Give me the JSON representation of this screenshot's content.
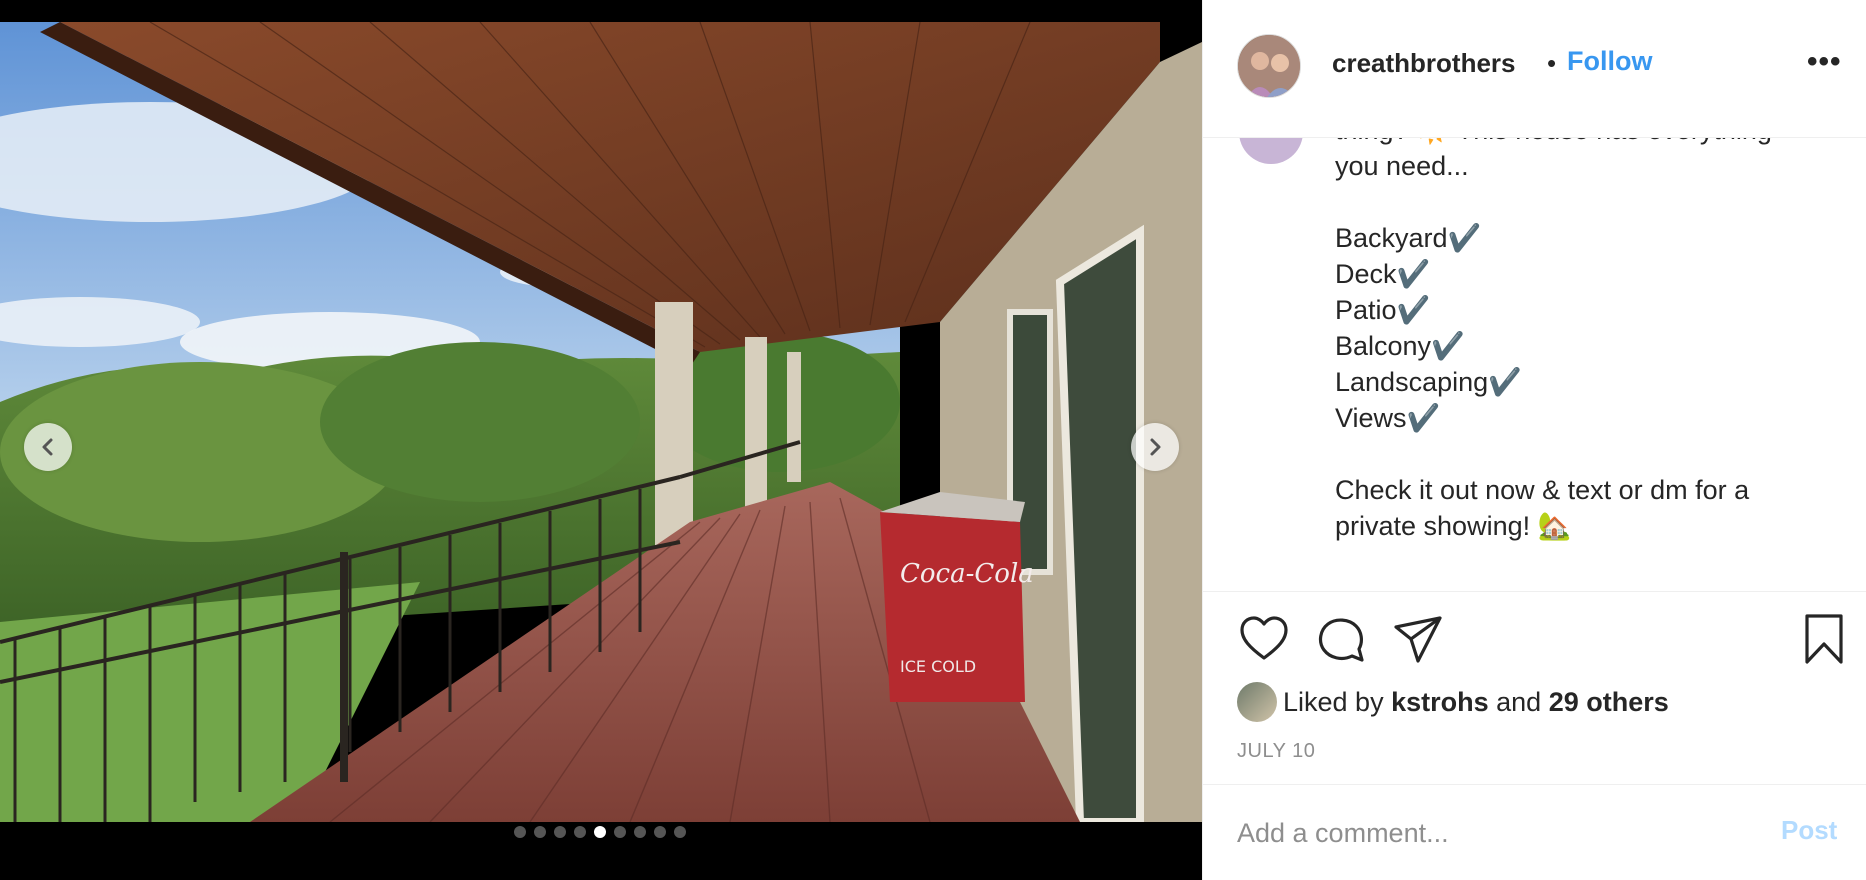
{
  "post": {
    "username": "creathbrothers",
    "separator": "•",
    "follow_label": "Follow",
    "more_label": "•••",
    "caption": "thing? ☀️ This house has everything\nyou need...\n\nBackyard✔️\nDeck✔️\nPatio✔️\nBalcony✔️\nLandscaping✔️\nViews✔️\n\nCheck it out now & text or dm for a\nprivate showing! 🏡",
    "likes": {
      "prefix": "Liked by ",
      "user": "kstrohs",
      "middle": " and ",
      "others": "29 others"
    },
    "date": "JULY 10",
    "comment": {
      "placeholder": "Add a comment...",
      "post_label": "Post"
    }
  },
  "carousel": {
    "slide_count": 9,
    "active_index": 4
  },
  "icons": {
    "like": "heart-icon",
    "comment": "comment-icon",
    "share": "paper-plane-icon",
    "save": "bookmark-icon",
    "prev": "chevron-left-icon",
    "next": "chevron-right-icon"
  },
  "colors": {
    "link": "#3897f0",
    "post_disabled": "#b3dbff",
    "muted": "#8e8e8e",
    "text": "#262626"
  }
}
